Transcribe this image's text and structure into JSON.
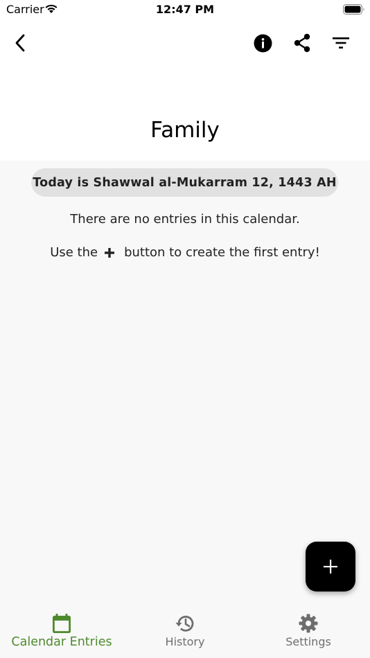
{
  "status_bar": {
    "carrier": "Carrier",
    "time": "12:47 PM"
  },
  "header": {
    "title": "Family",
    "back_icon": "chevron-left-icon",
    "actions": [
      "info-icon",
      "share-icon",
      "filter-icon"
    ]
  },
  "main": {
    "today_label": "Today is Shawwal al-Mukarram 12, 1443 AH",
    "empty_message": "There are no entries in this calendar.",
    "hint_before": "Use the",
    "hint_after": "button to create the first entry!"
  },
  "fab": {
    "icon": "plus-icon"
  },
  "tabs": [
    {
      "label": "Calendar Entries",
      "icon": "calendar-icon",
      "active": true
    },
    {
      "label": "History",
      "icon": "history-icon",
      "active": false
    },
    {
      "label": "Settings",
      "icon": "gear-icon",
      "active": false
    }
  ],
  "colors": {
    "accent": "#4e8a2c",
    "inactive": "#6e6e6e",
    "background": "#f8f8f8",
    "pill": "#e1e1e1"
  }
}
